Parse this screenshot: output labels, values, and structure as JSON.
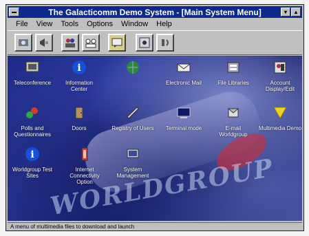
{
  "window": {
    "title": "The Galacticomm Demo System - [Main System Menu]"
  },
  "menu": [
    "File",
    "View",
    "Tools",
    "Options",
    "Window",
    "Help"
  ],
  "toolbar": {
    "buttons": [
      {
        "name": "teleconference-tool-icon"
      },
      {
        "name": "megaphone-tool-icon"
      },
      {
        "name": "users-tool-icon"
      },
      {
        "name": "group-tool-icon"
      },
      {
        "name": "chat-tool-icon"
      },
      {
        "name": "window-tool-icon"
      },
      {
        "name": "speaker-tool-icon"
      }
    ]
  },
  "icons": [
    {
      "label": "Teleconference"
    },
    {
      "label": "Information Center"
    },
    {
      "label": ""
    },
    {
      "label": "Electronic Mail"
    },
    {
      "label": "File Libraries"
    },
    {
      "label": "Account Display/Edit"
    },
    {
      "label": "Polls and Questionnaires"
    },
    {
      "label": "Doors"
    },
    {
      "label": "Registry of Users"
    },
    {
      "label": "Terminal mode"
    },
    {
      "label": "E-mail Worldgroup"
    },
    {
      "label": "Multimedia Demo"
    },
    {
      "label": "Worldgroup Test Sites"
    },
    {
      "label": "Internet Connectivity Option"
    },
    {
      "label": "System Management"
    }
  ],
  "wordmark": "WORLDGROUP",
  "status": "A menu of multimedia files to download and launch",
  "colors": {
    "titlebar": "#0c2a8c",
    "desktop": "#1e2b86"
  }
}
